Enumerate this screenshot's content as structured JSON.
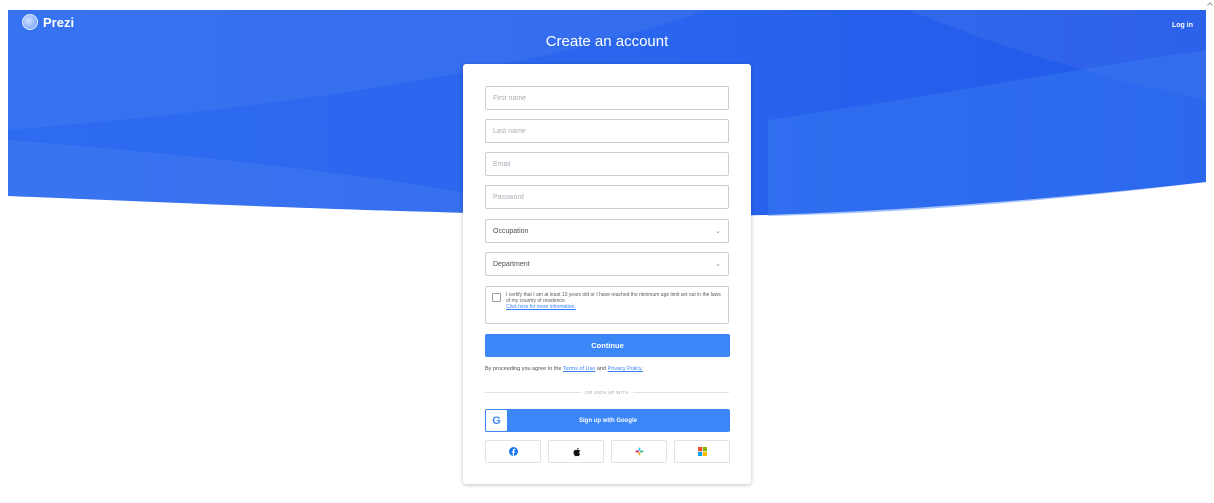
{
  "header": {
    "brand": "Prezi",
    "login_label": "Log in"
  },
  "page": {
    "title": "Create an account"
  },
  "form": {
    "first_name_placeholder": "First name",
    "last_name_placeholder": "Last name",
    "email_placeholder": "Email",
    "password_placeholder": "Password",
    "occupation_value": "Occupation",
    "department_value": "Department",
    "consent_text": "I certify that I am at least 13 years old or I have reached the minimum age limit set out in the laws of my country of residence.",
    "consent_link": "Click here for more information.",
    "continue_label": "Continue",
    "terms_prefix": "By proceeding you agree to the",
    "terms_link": "Terms of Use",
    "terms_and": "and",
    "privacy_link": "Privacy Policy.",
    "divider_text": "OR SIGN UP WITH",
    "google_label": "Sign up with Google",
    "google_glyph": "G"
  },
  "socials": [
    {
      "name": "facebook-icon"
    },
    {
      "name": "apple-icon"
    },
    {
      "name": "slack-icon"
    },
    {
      "name": "microsoft-icon"
    }
  ],
  "colors": {
    "brand_blue": "#2f6ef0",
    "button_blue": "#3b87f7",
    "link_blue": "#3b82f6"
  }
}
